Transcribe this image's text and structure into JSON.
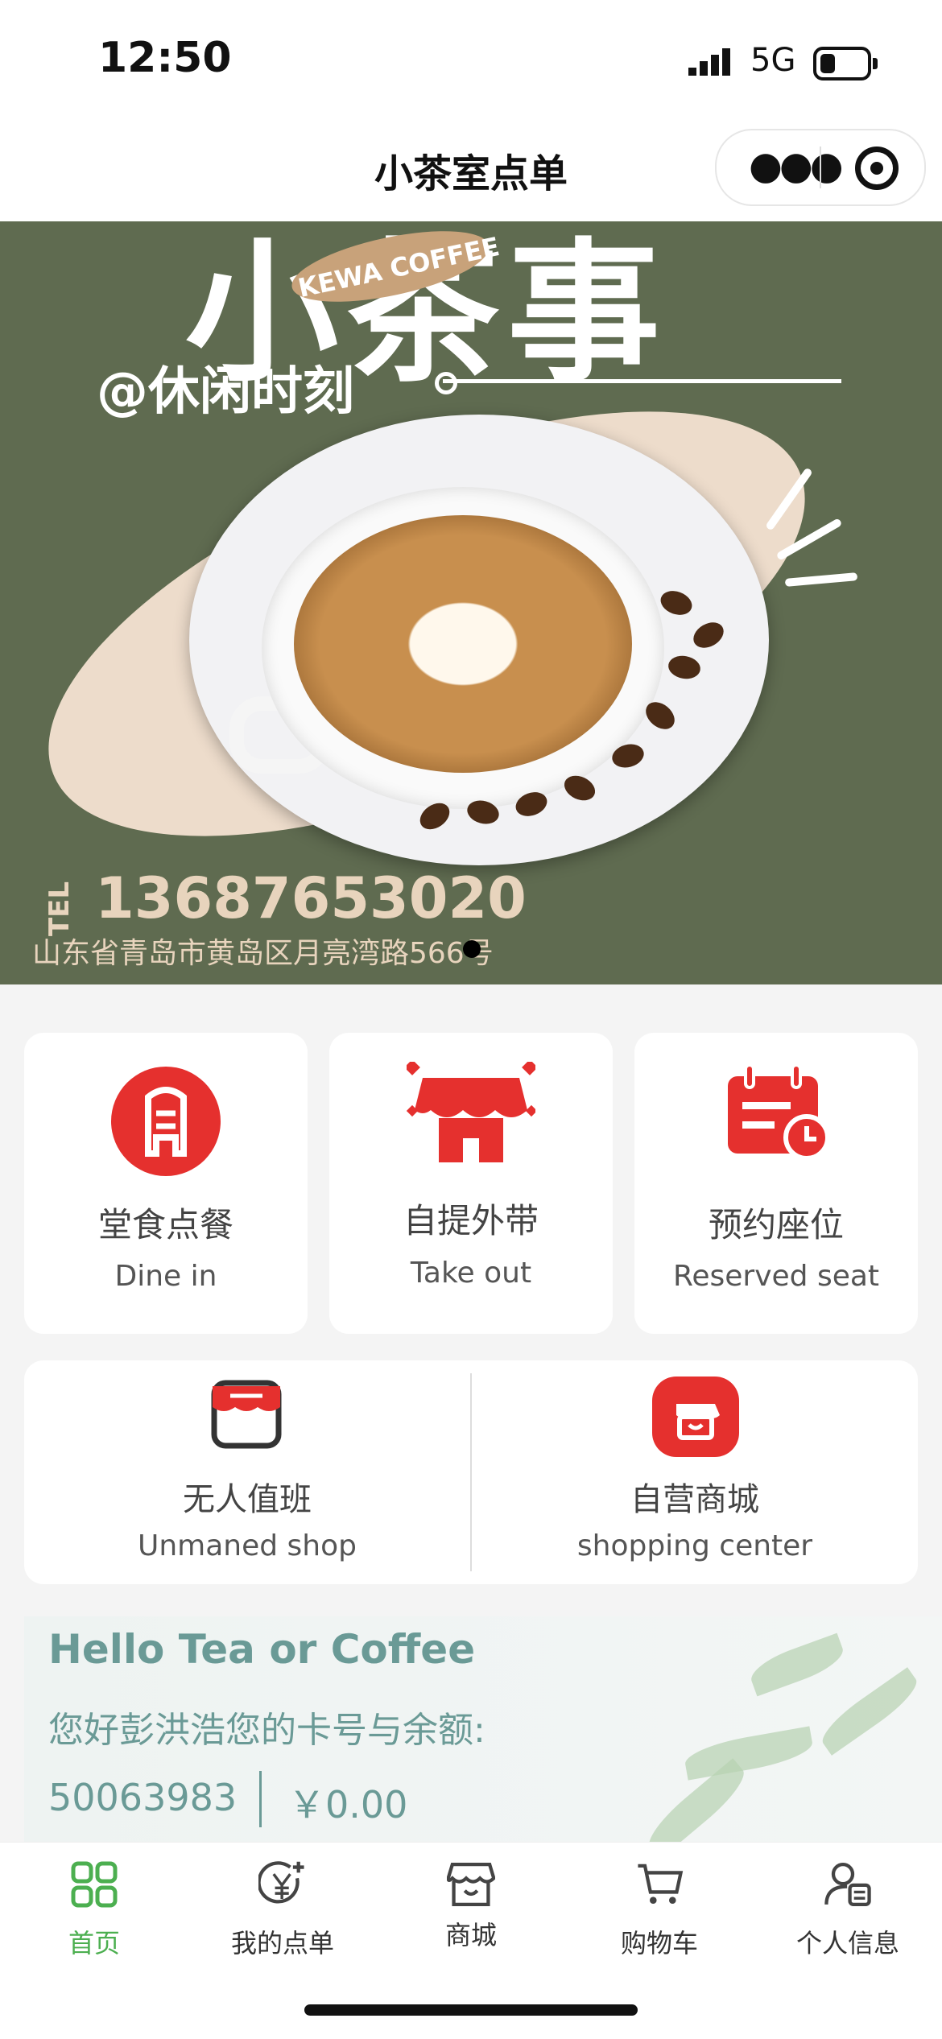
{
  "status_bar": {
    "time": "12:50",
    "network": "5G"
  },
  "navbar": {
    "title": "小茶室点单"
  },
  "banner": {
    "title": "小茶事",
    "brand": "KEWA COFFEE",
    "tagline": "@休闲时刻",
    "tel_label": "TEL",
    "phone": "13687653020",
    "address": "山东省青岛市黄岛区月亮湾路566号"
  },
  "services": [
    {
      "cn": "堂食点餐",
      "en": "Dine in",
      "icon": "dine-in-icon"
    },
    {
      "cn": "自提外带",
      "en": "Take out",
      "icon": "storefront-icon"
    },
    {
      "cn": "预约座位",
      "en": "Reserved seat",
      "icon": "calendar-clock-icon"
    }
  ],
  "shops": [
    {
      "cn": "无人值班",
      "en": "Unmaned shop",
      "icon": "shop-icon"
    },
    {
      "cn": "自营商城",
      "en": "shopping center",
      "icon": "mall-icon"
    }
  ],
  "member": {
    "hello": "Hello Tea or Coffee",
    "greeting": "您好彭洪浩您的卡号与余额:",
    "card_number": "50063983",
    "balance": "￥0.00"
  },
  "tabbar": [
    {
      "label": "首页",
      "icon": "grid-icon",
      "active": true
    },
    {
      "label": "我的点单",
      "icon": "yen-plus-icon",
      "active": false
    },
    {
      "label": "商城",
      "icon": "store-icon",
      "active": false
    },
    {
      "label": "购物车",
      "icon": "cart-icon",
      "active": false
    },
    {
      "label": "个人信息",
      "icon": "user-card-icon",
      "active": false
    }
  ],
  "colors": {
    "accent_red": "#e5302e",
    "active_green": "#4caf50",
    "banner_green": "#5f6b50",
    "member_teal": "#6a9a96"
  }
}
